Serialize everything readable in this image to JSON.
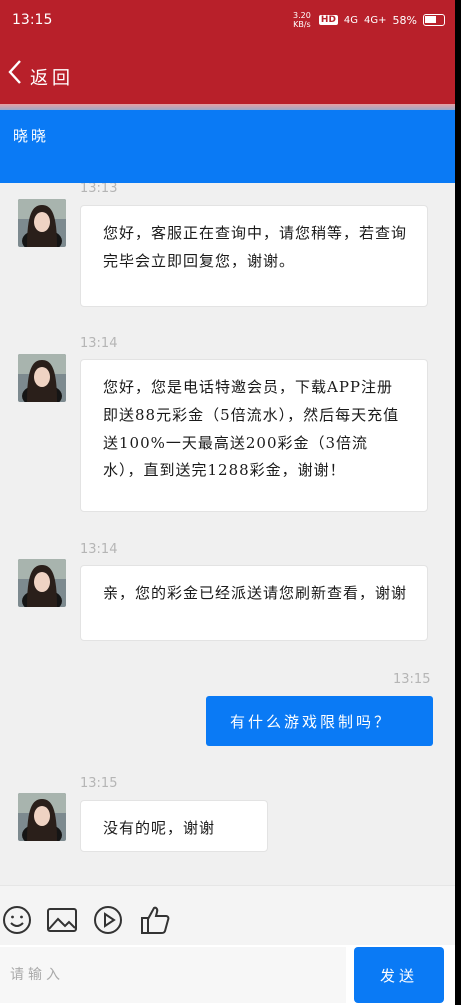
{
  "status_bar": {
    "time": "13:15",
    "network_speed": "3.20 KB/s",
    "hd_badge": "HD",
    "signal_1": "4G",
    "signal_2": "4G+",
    "battery": "58%"
  },
  "nav": {
    "back_icon": "chevron-left-icon",
    "title": "返回"
  },
  "chat": {
    "contact_name": "晓晓"
  },
  "messages": [
    {
      "time": "13:13",
      "direction": "incoming",
      "text": "您好，客服正在查询中，请您稍等，若查询完毕会立即回复您，谢谢。"
    },
    {
      "time": "13:14",
      "direction": "incoming",
      "text": "您好，您是电话特邀会员，下载APP注册即送88元彩金（5倍流水），然后每天充值送100%一天最高送200彩金（3倍流水），直到送完1288彩金，谢谢！"
    },
    {
      "time": "13:14",
      "direction": "incoming",
      "text": "亲，您的彩金已经派送请您刷新查看，谢谢"
    },
    {
      "time": "13:15",
      "direction": "outgoing",
      "text": "有什么游戏限制吗？"
    },
    {
      "time": "13:15",
      "direction": "incoming",
      "text": "没有的呢，谢谢"
    }
  ],
  "toolbar": {
    "icons": [
      "emoji-icon",
      "image-icon",
      "video-play-icon",
      "thumbs-up-icon"
    ]
  },
  "composer": {
    "placeholder": "请输入",
    "send_label": "发送"
  },
  "colors": {
    "header_red": "#b8202a",
    "accent_blue": "#0a7af5"
  }
}
